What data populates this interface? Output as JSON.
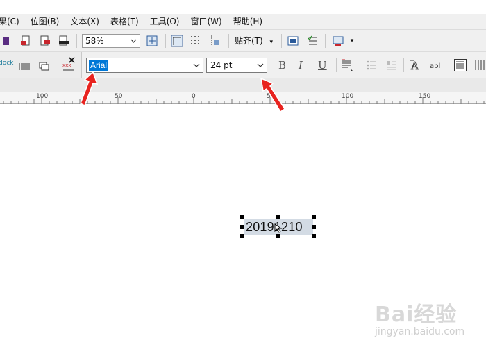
{
  "menubar": {
    "items": [
      "果(C)",
      "位图(B)",
      "文本(X)",
      "表格(T)",
      "工具(O)",
      "窗口(W)",
      "帮助(H)"
    ]
  },
  "toolbar": {
    "zoom_value": "58%",
    "snap_label": "贴齐(T)"
  },
  "property_bar": {
    "panel_label": "dock",
    "font_name": "Arial",
    "font_size": "24 pt",
    "bold_label": "B",
    "italic_label": "I",
    "underline_label": "U",
    "abl_label": "abl"
  },
  "ruler": {
    "labels": [
      "100",
      "50",
      "0",
      "50",
      "100",
      "150"
    ]
  },
  "canvas": {
    "text_object": "20191210"
  },
  "watermark": {
    "brand": "Bai经验",
    "url": "jingyan.baidu.com"
  },
  "colors": {
    "selection": "#0078d7",
    "arrow": "#e8231f",
    "text_highlight": "#d3dbe4"
  }
}
